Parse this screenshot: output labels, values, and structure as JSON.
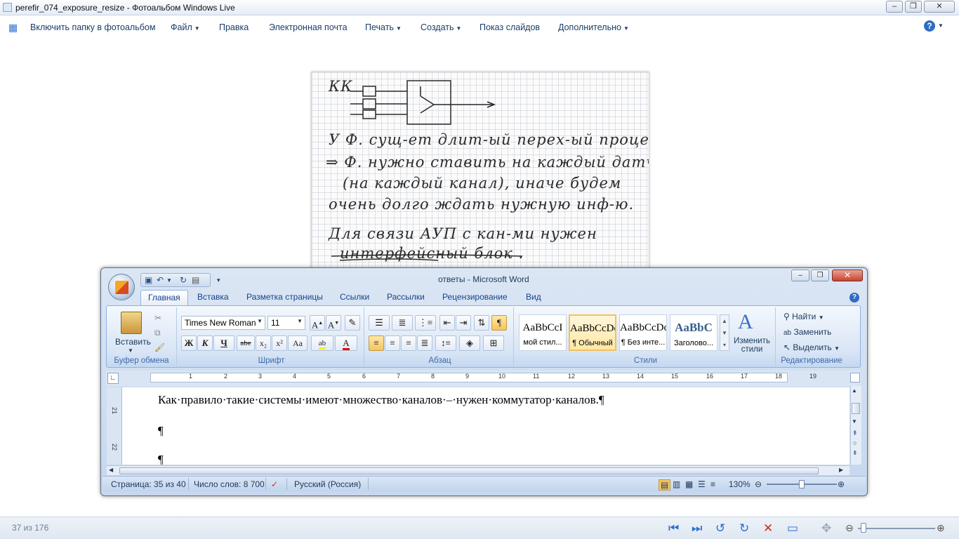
{
  "photo_gallery": {
    "title": "perefir_074_exposure_resize - Фотоальбом Windows Live",
    "menu": {
      "include_folder": "Включить папку в фотоальбом",
      "file": "Файл",
      "edit": "Правка",
      "email": "Электронная почта",
      "print": "Печать",
      "create": "Создать",
      "slideshow": "Показ слайдов",
      "extra": "Дополнительно"
    },
    "status": {
      "counter": "37 из 176"
    }
  },
  "handwriting": {
    "kk": "КК",
    "line1": "У Ф. сущ-ет длит-ый перех-ый процесс.",
    "line2": "⇒ Ф. нужно ставить на каждый датчик",
    "line3": "(на каждый канал), иначе будем",
    "line4": "очень долго ждать нужную инф-ю.",
    "line5": "Для связи АУП с кан-ми нужен",
    "line6": "интерфейсный блок ."
  },
  "word": {
    "title": "ответы - Microsoft Word",
    "tabs": [
      "Главная",
      "Вставка",
      "Разметка страницы",
      "Ссылки",
      "Рассылки",
      "Рецензирование",
      "Вид"
    ],
    "groups": {
      "clipboard": "Буфер обмена",
      "font": "Шрифт",
      "paragraph": "Абзац",
      "styles": "Стили",
      "editing": "Редактирование"
    },
    "paste_label": "Вставить",
    "font_name": "Times New Roman",
    "font_size": "11",
    "styles": [
      {
        "preview": "AaBbCcI",
        "name": "мой стил..."
      },
      {
        "preview": "AaBbCcDc",
        "name": "¶ Обычный"
      },
      {
        "preview": "AaBbCcDc",
        "name": "¶ Без инте..."
      },
      {
        "preview": "AaBbC",
        "name": "Заголово..."
      }
    ],
    "change_styles": "Изменить стили",
    "find": "Найти",
    "replace": "Заменить",
    "select": "Выделить",
    "document": {
      "line1": "Как·правило·такие·системы·имеют·множество·каналов·–·нужен·коммутатор·каналов.¶",
      "pilcrow": "¶"
    },
    "status": {
      "page": "Страница: 35 из 40",
      "words": "Число слов: 8 700",
      "language": "Русский (Россия)",
      "zoom": "130%"
    }
  }
}
